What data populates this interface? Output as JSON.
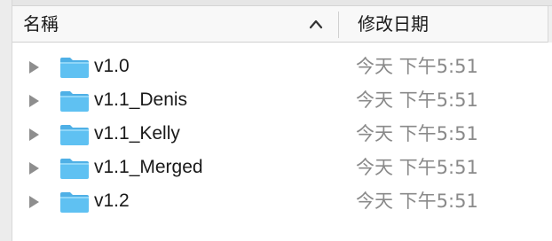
{
  "header": {
    "name_label": "名稱",
    "date_label": "修改日期",
    "sort_direction": "ascending"
  },
  "rows": [
    {
      "name": "v1.0",
      "date": "今天 下午5:51",
      "icon": "folder-icon"
    },
    {
      "name": "v1.1_Denis",
      "date": "今天 下午5:51",
      "icon": "folder-icon"
    },
    {
      "name": "v1.1_Kelly",
      "date": "今天 下午5:51",
      "icon": "folder-icon"
    },
    {
      "name": "v1.1_Merged",
      "date": "今天 下午5:51",
      "icon": "folder-icon"
    },
    {
      "name": "v1.2",
      "date": "今天 下午5:51",
      "icon": "folder-icon"
    }
  ],
  "colors": {
    "folder": "#5fc1f2",
    "folder_tab": "#4fb0e6",
    "disclosure": "#8e8e8e",
    "date_text": "#8a8a8a"
  }
}
